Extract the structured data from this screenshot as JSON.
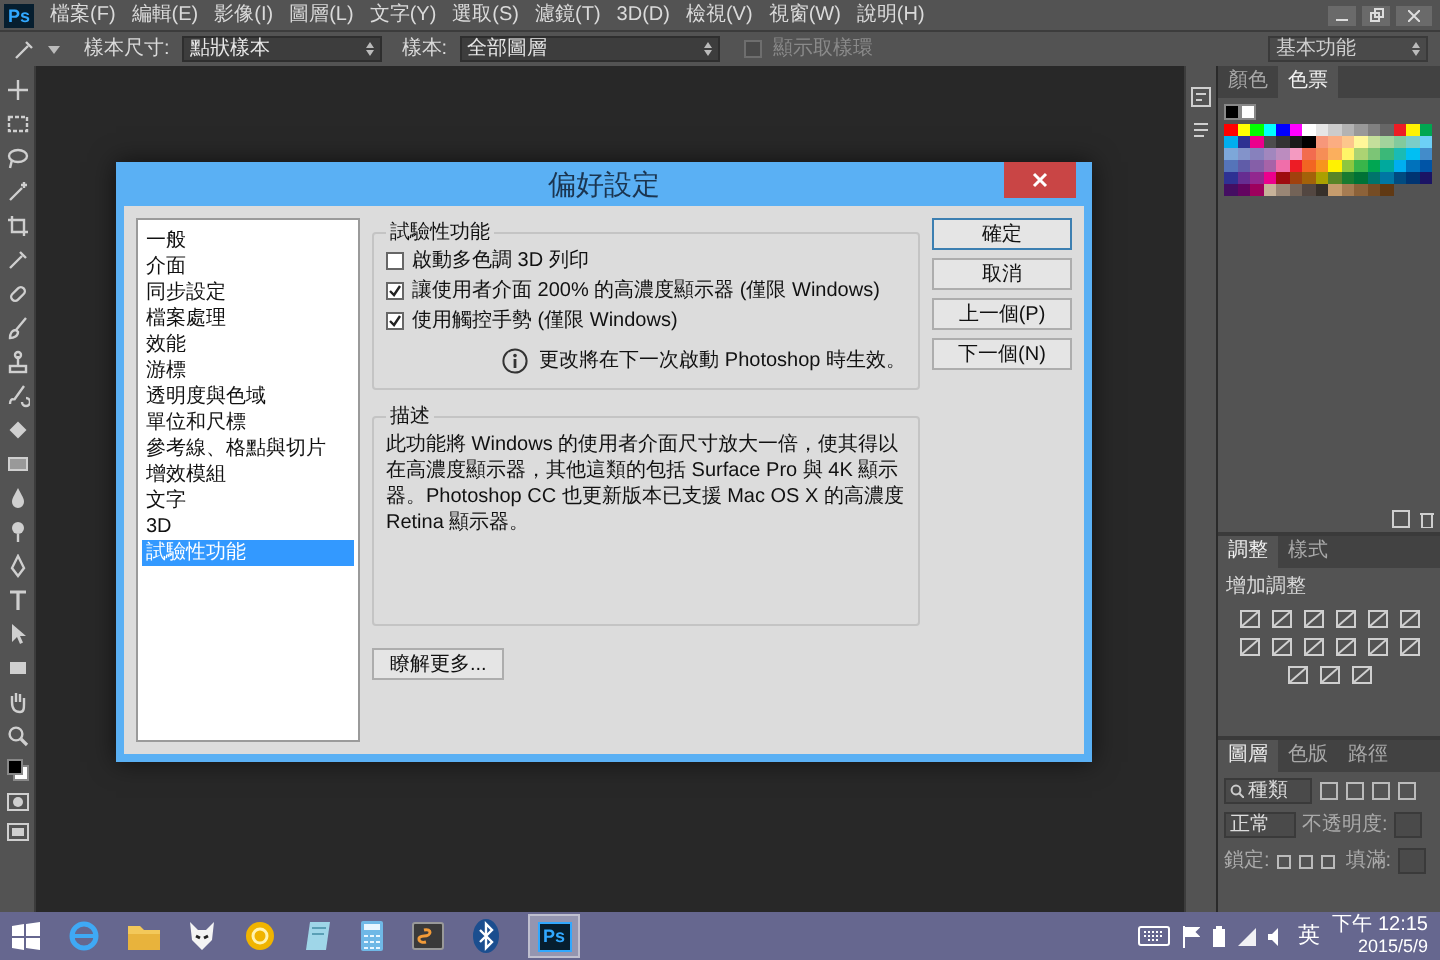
{
  "app": {
    "logo": "Ps",
    "menu": [
      "檔案(F)",
      "編輯(E)",
      "影像(I)",
      "圖層(L)",
      "文字(Y)",
      "選取(S)",
      "濾鏡(T)",
      "3D(D)",
      "檢視(V)",
      "視窗(W)",
      "說明(H)"
    ]
  },
  "options_bar": {
    "sample_size_label": "樣本尺寸:",
    "sample_size": "點狀樣本",
    "sample_label": "樣本:",
    "sample": "全部圖層",
    "show_ring": {
      "label": "顯示取樣環",
      "checked": false,
      "disabled": true
    },
    "workspace": "基本功能"
  },
  "dialog": {
    "title": "偏好設定",
    "categories": [
      {
        "label": "一般",
        "selected": false
      },
      {
        "label": "介面",
        "selected": false
      },
      {
        "label": "同步設定",
        "selected": false
      },
      {
        "label": "檔案處理",
        "selected": false
      },
      {
        "label": "效能",
        "selected": false
      },
      {
        "label": "游標",
        "selected": false
      },
      {
        "label": "透明度與色域",
        "selected": false
      },
      {
        "label": "單位和尺標",
        "selected": false
      },
      {
        "label": "參考線、格點與切片",
        "selected": false
      },
      {
        "label": "增效模組",
        "selected": false
      },
      {
        "label": "文字",
        "selected": false
      },
      {
        "label": "3D",
        "selected": false
      },
      {
        "label": "試驗性功能",
        "selected": true
      }
    ],
    "group_title": "試驗性功能",
    "options": [
      {
        "label": "啟動多色調 3D 列印",
        "checked": false
      },
      {
        "label": "讓使用者介面 200% 的高濃度顯示器 (僅限 Windows)",
        "checked": true
      },
      {
        "label": "使用觸控手勢 (僅限 Windows)",
        "checked": true
      }
    ],
    "notice": "更改將在下一次啟動 Photoshop 時生效。",
    "description_title": "描述",
    "description": "此功能將 Windows 的使用者介面尺寸放大一倍，使其得以在高濃度顯示器，其他這類的包括 Surface Pro 與 4K 顯示器。Photoshop CC 也更新版本已支援 Mac OS X 的高濃度 Retina 顯示器。",
    "learn_more": "瞭解更多...",
    "buttons": [
      "確定",
      "取消",
      "上一個(P)",
      "下一個(N)"
    ]
  },
  "panels": {
    "swatch_tabs": [
      {
        "label": "顏色",
        "selected": false
      },
      {
        "label": "色票",
        "selected": true
      }
    ],
    "swatches": [
      {
        "color": "#ff0000"
      },
      {
        "color": "#ffff00"
      },
      {
        "color": "#00ff00"
      },
      {
        "color": "#00ffff"
      },
      {
        "color": "#0000ff"
      },
      {
        "color": "#ff00ff"
      },
      {
        "color": "#ffffff"
      },
      {
        "color": "#e6e6e6"
      },
      {
        "color": "#cccccc"
      },
      {
        "color": "#b3b3b3"
      },
      {
        "color": "#999999"
      },
      {
        "color": "#808080"
      },
      {
        "color": "#666666"
      },
      {
        "color": "#ed1c24"
      },
      {
        "color": "#fff200"
      },
      {
        "color": "#00a651"
      },
      {
        "color": "#00aeef"
      },
      {
        "color": "#2e3192"
      },
      {
        "color": "#ec008c"
      },
      {
        "color": "#4d4d4d"
      },
      {
        "color": "#333333"
      },
      {
        "color": "#1a1a1a"
      },
      {
        "color": "#000000"
      },
      {
        "color": "#f7977a"
      },
      {
        "color": "#fbad82"
      },
      {
        "color": "#fdc68c"
      },
      {
        "color": "#fff799"
      },
      {
        "color": "#c4df9b"
      },
      {
        "color": "#a3d39c"
      },
      {
        "color": "#82ca9d"
      },
      {
        "color": "#7bcdc8"
      },
      {
        "color": "#6dcff6"
      },
      {
        "color": "#7da7d9"
      },
      {
        "color": "#8393ca"
      },
      {
        "color": "#8781bd"
      },
      {
        "color": "#a187be"
      },
      {
        "color": "#bc8cbf"
      },
      {
        "color": "#f49ac1"
      },
      {
        "color": "#f26c4f"
      },
      {
        "color": "#f68e56"
      },
      {
        "color": "#fbaf5d"
      },
      {
        "color": "#fff468"
      },
      {
        "color": "#acd373"
      },
      {
        "color": "#7cc576"
      },
      {
        "color": "#3bb878"
      },
      {
        "color": "#1abbb4"
      },
      {
        "color": "#00bff3"
      },
      {
        "color": "#438cca"
      },
      {
        "color": "#5574b9"
      },
      {
        "color": "#605ca8"
      },
      {
        "color": "#855fa8"
      },
      {
        "color": "#a763a8"
      },
      {
        "color": "#f06eaa"
      },
      {
        "color": "#ed1c25"
      },
      {
        "color": "#f26522"
      },
      {
        "color": "#f7941d"
      },
      {
        "color": "#fff201"
      },
      {
        "color": "#8dc73f"
      },
      {
        "color": "#39b54a"
      },
      {
        "color": "#00a652"
      },
      {
        "color": "#00a99d"
      },
      {
        "color": "#00aef0"
      },
      {
        "color": "#0072bc"
      },
      {
        "color": "#0054a6"
      },
      {
        "color": "#2e3193"
      },
      {
        "color": "#662d91"
      },
      {
        "color": "#92278f"
      },
      {
        "color": "#ec008d"
      },
      {
        "color": "#9e0b0f"
      },
      {
        "color": "#a0410d"
      },
      {
        "color": "#a36209"
      },
      {
        "color": "#aba000"
      },
      {
        "color": "#598527"
      },
      {
        "color": "#197b30"
      },
      {
        "color": "#007236"
      },
      {
        "color": "#00746b"
      },
      {
        "color": "#0076a3"
      },
      {
        "color": "#004b80"
      },
      {
        "color": "#003471"
      },
      {
        "color": "#1b1464"
      },
      {
        "color": "#440e62"
      },
      {
        "color": "#630460"
      },
      {
        "color": "#9e005d"
      },
      {
        "color": "#c7b299"
      },
      {
        "color": "#998675"
      },
      {
        "color": "#736357"
      },
      {
        "color": "#534741"
      },
      {
        "color": "#37302a"
      },
      {
        "color": "#c69c6d"
      },
      {
        "color": "#a67c52"
      },
      {
        "color": "#8c6239"
      },
      {
        "color": "#754c24"
      },
      {
        "color": "#603913"
      }
    ],
    "adjust_tabs": [
      {
        "label": "調整",
        "selected": true
      },
      {
        "label": "樣式",
        "selected": false
      }
    ],
    "adjust_hint": "增加調整",
    "layer_tabs": [
      {
        "label": "圖層",
        "selected": true
      },
      {
        "label": "色版",
        "selected": false
      },
      {
        "label": "路徑",
        "selected": false
      }
    ],
    "layer_filter": "種類",
    "blend_mode": "正常",
    "opacity_label": "不透明度:",
    "lock_label": "鎖定:",
    "fill_label": "填滿:"
  },
  "taskbar": {
    "ps_label": "Ps",
    "ime": "英",
    "time": "下午 12:15",
    "date": "2015/5/9"
  }
}
